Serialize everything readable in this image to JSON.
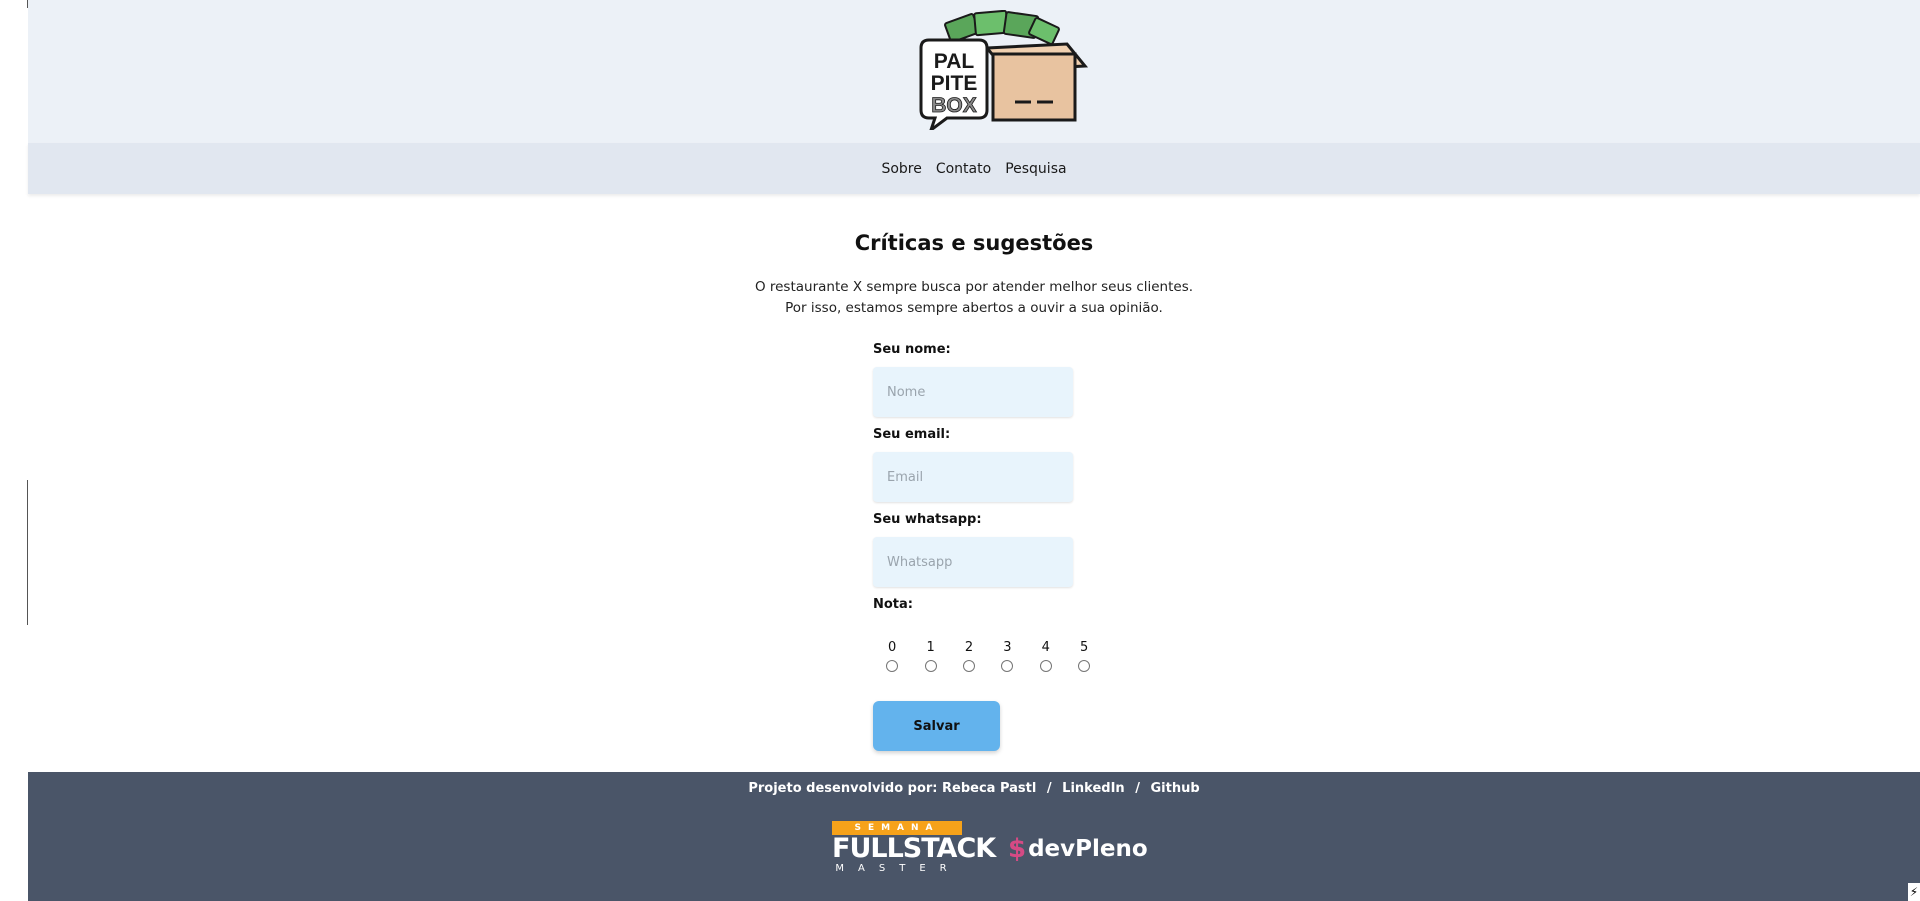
{
  "brand": {
    "logo_lines": [
      "PAL",
      "PITE",
      "BOX"
    ],
    "logo_colors": {
      "box": "#e8c3a0",
      "outline": "#1a1a1a",
      "money": "#5aa65a",
      "bubble": "#ffffff"
    }
  },
  "nav": {
    "items": [
      {
        "label": "Sobre"
      },
      {
        "label": "Contato"
      },
      {
        "label": "Pesquisa"
      }
    ]
  },
  "main": {
    "title": "Críticas e sugestões",
    "intro_line1": "O restaurante X sempre busca por atender melhor seus clientes.",
    "intro_line2": "Por isso, estamos sempre abertos a ouvir a sua opinião."
  },
  "form": {
    "name_label": "Seu nome:",
    "name_placeholder": "Nome",
    "name_value": "",
    "email_label": "Seu email:",
    "email_placeholder": "Email",
    "email_value": "",
    "whatsapp_label": "Seu whatsapp:",
    "whatsapp_placeholder": "Whatsapp",
    "whatsapp_value": "",
    "rating_label": "Nota:",
    "rating_options": [
      "0",
      "1",
      "2",
      "3",
      "4",
      "5"
    ],
    "rating_selected": null,
    "save_label": "Salvar"
  },
  "footer": {
    "credits_prefix": "Projeto desenvolvido por: Rebeca Pastl",
    "slash1": "/",
    "linkedin_label": "LinkedIn",
    "slash2": "/",
    "github_label": "Github",
    "fullstack_top": "SEMANA",
    "fullstack_main": "FULLSTACK",
    "fullstack_bottom": "MASTER",
    "devpleno_symbol": "$",
    "devpleno_text": "devPleno"
  },
  "colors": {
    "logo_bar_bg": "#ecf1f7",
    "nav_bg": "#e1e7f0",
    "input_bg": "#e8f4fc",
    "save_button_bg": "#63b3ed",
    "footer_bg": "#4a5568",
    "fullstack_accent": "#f6a21a",
    "devpleno_accent": "#d54a84"
  }
}
